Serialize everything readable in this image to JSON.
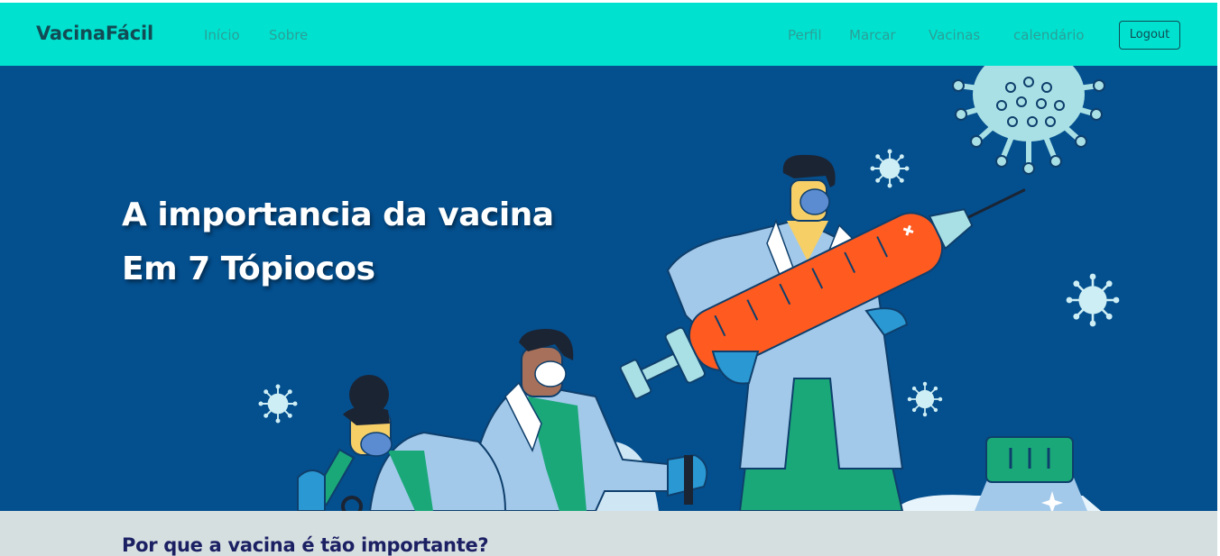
{
  "navbar": {
    "brand": "VacinaFácil",
    "left_links": [
      "Início",
      "Sobre"
    ],
    "right_links": [
      "Perfil",
      "Marcar",
      "Vacinas",
      "calendário"
    ],
    "logout_label": "Logout"
  },
  "hero": {
    "title_line1": "A importancia da vacina",
    "title_line2": "Em 7 Tópiocos"
  },
  "section": {
    "title": "Por que a vacina é tão importante?"
  },
  "colors": {
    "navbar_bg": "#00e2cf",
    "hero_bg": "#044f8e",
    "section_bg": "#d6dfe0",
    "syringe": "#ff5a1f",
    "scrubs": "#1aa879",
    "coat": "#a3c9ea"
  },
  "icons": [
    "virus-icon",
    "syringe-icon",
    "sparkle-icon"
  ]
}
